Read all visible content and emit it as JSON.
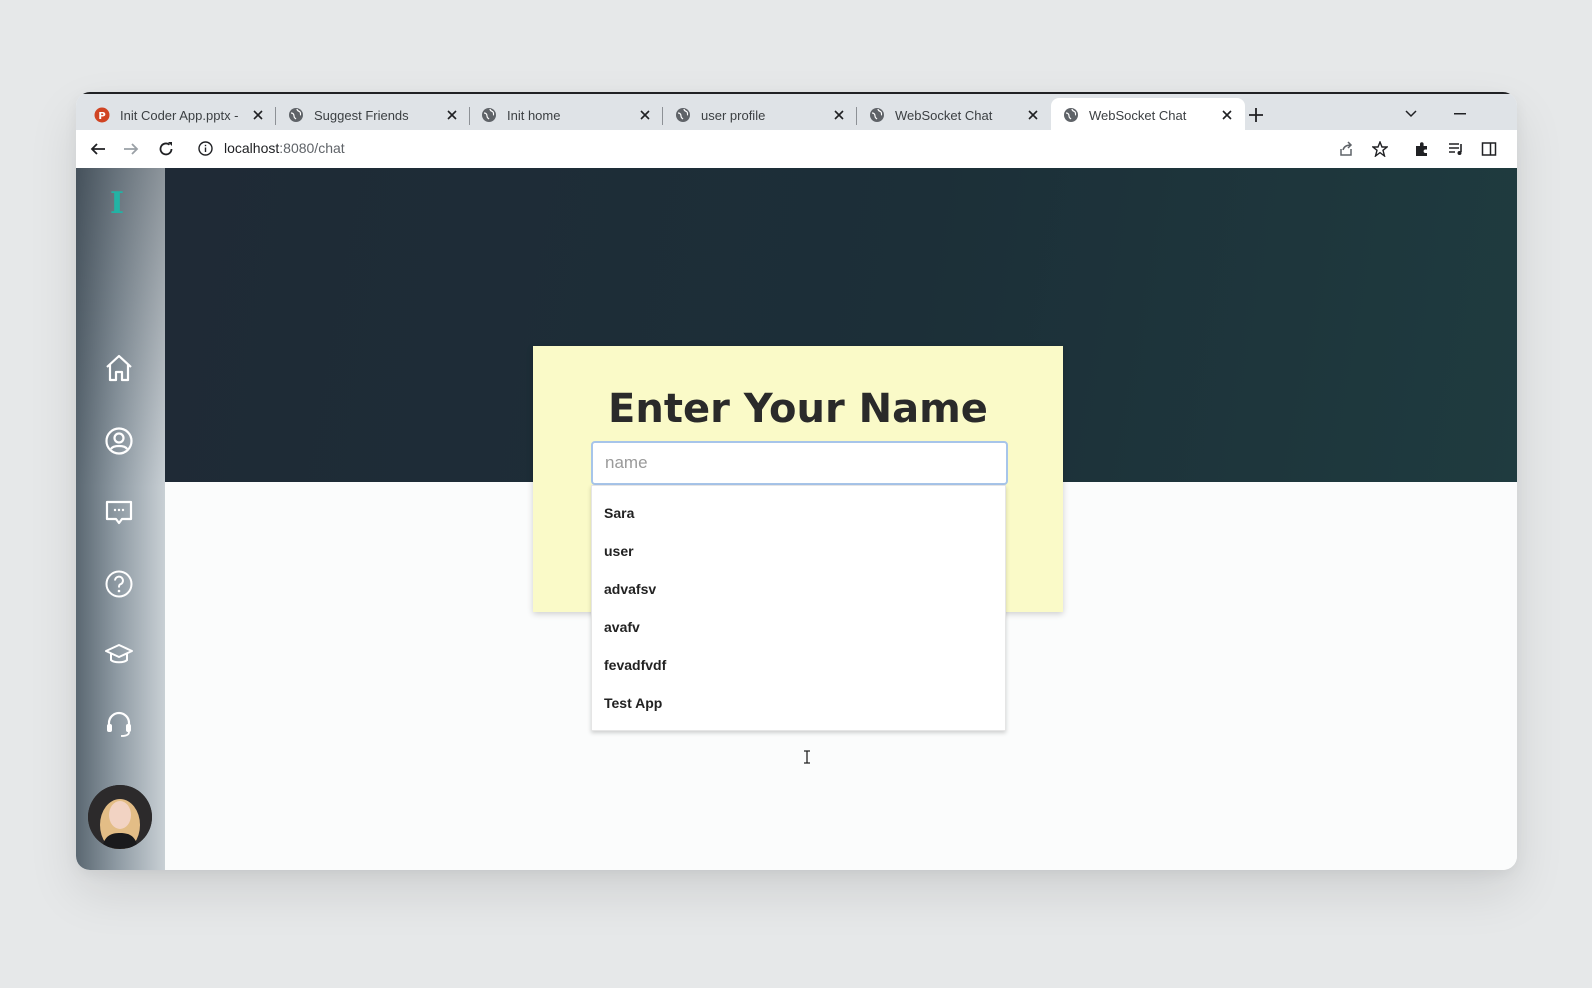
{
  "browser": {
    "tabs": [
      {
        "title": "Init Coder App.pptx -",
        "favicon": "powerpoint-icon"
      },
      {
        "title": "Suggest Friends",
        "favicon": "globe-icon"
      },
      {
        "title": "Init home",
        "favicon": "globe-icon"
      },
      {
        "title": "user profile",
        "favicon": "globe-icon"
      },
      {
        "title": "WebSocket Chat",
        "favicon": "globe-icon"
      },
      {
        "title": "WebSocket Chat",
        "favicon": "globe-icon",
        "active": true
      }
    ],
    "url": {
      "host": "localhost",
      "path": ":8080/chat"
    }
  },
  "sidebar": {
    "logo": "I",
    "items": [
      {
        "icon": "home-icon"
      },
      {
        "icon": "user-circle-icon"
      },
      {
        "icon": "chat-icon"
      },
      {
        "icon": "help-icon"
      },
      {
        "icon": "graduation-cap-icon"
      },
      {
        "icon": "headset-icon"
      }
    ],
    "avatar": "user-avatar"
  },
  "card": {
    "title": "Enter Your Name",
    "input_placeholder": "name",
    "input_value": ""
  },
  "suggestions": [
    "Sara",
    "user",
    "advafsv",
    "avafv",
    "fevadfvdf",
    "Test App"
  ],
  "colors": {
    "logo": "#22b3a5",
    "card_bg": "#fafac8",
    "hero_bg": "#1f2a36",
    "input_focus": "#a7c5ea"
  }
}
